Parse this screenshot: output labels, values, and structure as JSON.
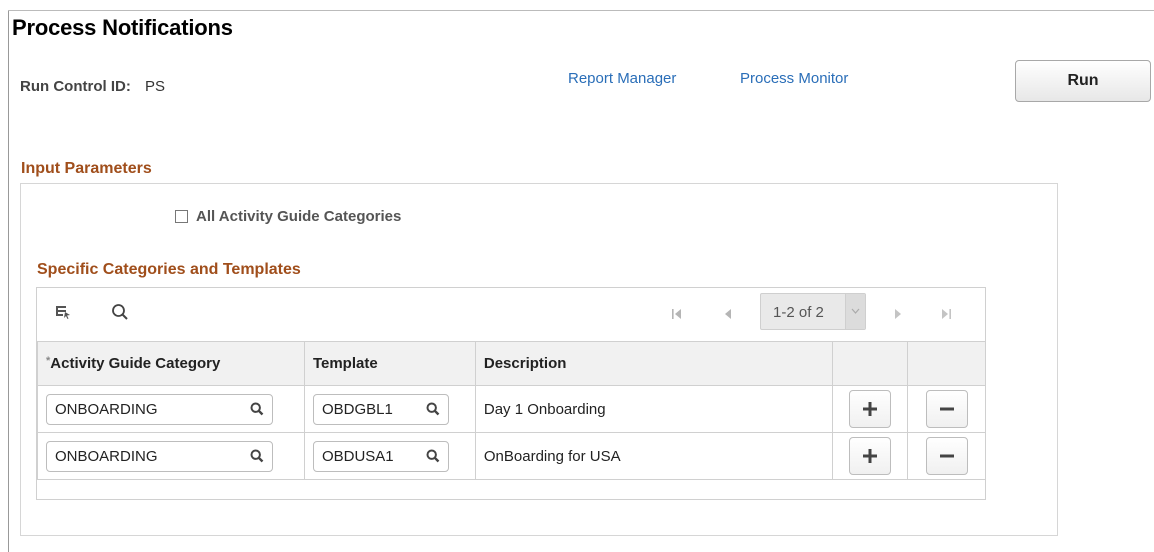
{
  "page": {
    "title": "Process Notifications"
  },
  "run_control": {
    "label": "Run Control ID:",
    "value": "PS"
  },
  "links": {
    "report_manager": "Report Manager",
    "process_monitor": "Process Monitor"
  },
  "run_button": "Run",
  "input_parameters": {
    "title": "Input Parameters",
    "all_categories_label": "All Activity Guide Categories",
    "all_categories_checked": false
  },
  "specific": {
    "title": "Specific Categories and Templates",
    "pager": "1-2 of 2",
    "columns": {
      "category": "Activity Guide Category",
      "template": "Template",
      "description": "Description"
    },
    "rows": [
      {
        "category": "ONBOARDING",
        "template": "OBDGBL1",
        "description": "Day 1 Onboarding"
      },
      {
        "category": "ONBOARDING",
        "template": "OBDUSA1",
        "description": "OnBoarding for USA"
      }
    ]
  },
  "colors": {
    "link": "#2a6eb8",
    "section_title": "#a04e1b"
  },
  "icons": {
    "personalize": "grid-personalize-icon",
    "find": "search-icon",
    "first": "first-page-icon",
    "previous": "previous-page-icon",
    "next": "next-page-icon",
    "last": "last-page-icon",
    "lookup": "magnifier-icon",
    "add": "plus-icon",
    "delete": "minus-icon"
  }
}
